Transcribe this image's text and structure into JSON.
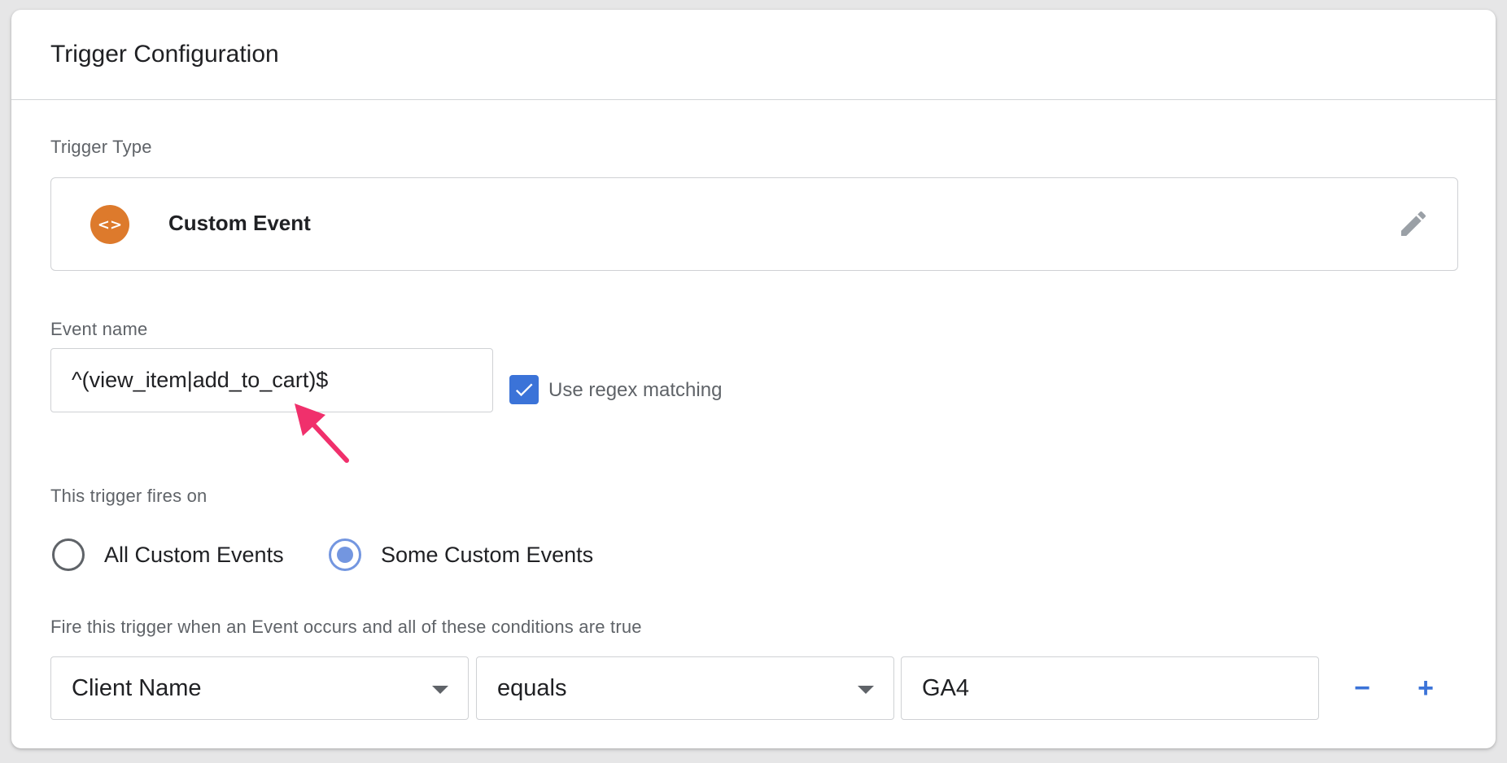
{
  "header": {
    "title": "Trigger Configuration"
  },
  "trigger_type": {
    "label": "Trigger Type",
    "name": "Custom Event",
    "icon_glyph": "<>",
    "icon": "code-brackets-icon",
    "edit_icon": "pencil-icon",
    "icon_color": "#dd7a2c"
  },
  "event_name": {
    "label": "Event name",
    "value": "^(view_item|add_to_cart)$",
    "regex_checked": true,
    "regex_label": "Use regex matching"
  },
  "fires_on": {
    "label": "This trigger fires on",
    "options": [
      {
        "label": "All Custom Events",
        "selected": false
      },
      {
        "label": "Some Custom Events",
        "selected": true
      }
    ]
  },
  "conditions": {
    "label": "Fire this trigger when an Event occurs and all of these conditions are true",
    "variable": "Client Name",
    "operator": "equals",
    "value": "GA4",
    "remove_symbol": "−",
    "add_symbol": "+"
  },
  "colors": {
    "accent": "#3b73d8",
    "radio_selected": "#7396e0",
    "annotation_arrow": "#f0306c"
  }
}
